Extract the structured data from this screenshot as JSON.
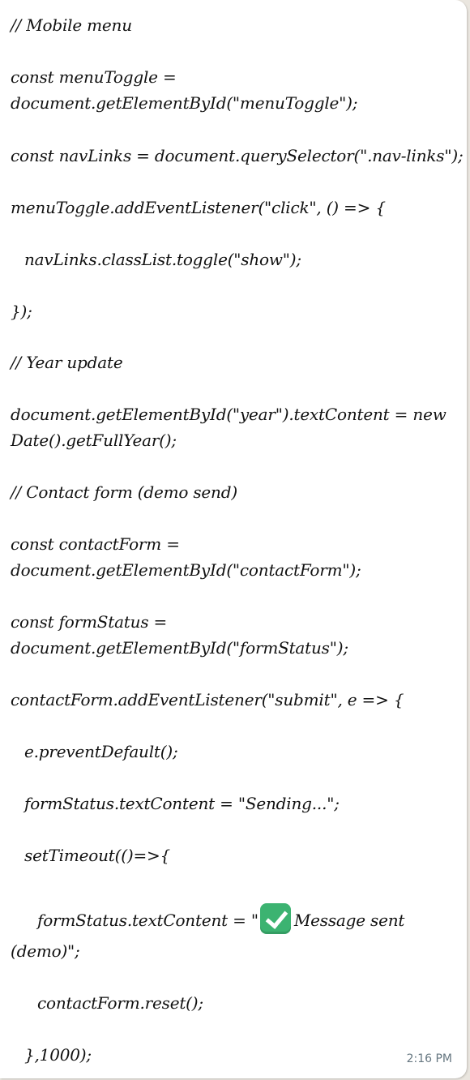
{
  "message": {
    "lines": [
      "// Mobile menu",
      "const menuToggle =",
      "document.getElementById(\"menuToggle\");",
      "const navLinks = document.querySelector(\".nav-links\");",
      "menuToggle.addEventListener(\"click\", () => {",
      "navLinks.classList.toggle(\"show\");",
      "});",
      "// Year update",
      "document.getElementById(\"year\").textContent = new",
      "Date().getFullYear();",
      "// Contact form (demo send)",
      "const contactForm =",
      "document.getElementById(\"contactForm\");",
      "const formStatus =",
      "document.getElementById(\"formStatus\");",
      "contactForm.addEventListener(\"submit\", e => {",
      "e.preventDefault();",
      "formStatus.textContent = \"Sending...\";",
      "setTimeout(()=>{",
      "formStatus.textContent = \"",
      "Message sent",
      "(demo)\";",
      "contactForm.reset();",
      "},1000);"
    ],
    "timestamp": "2:16 PM",
    "emoji_icon": "check-mark-button-icon",
    "accent_color": "#3cb371"
  }
}
